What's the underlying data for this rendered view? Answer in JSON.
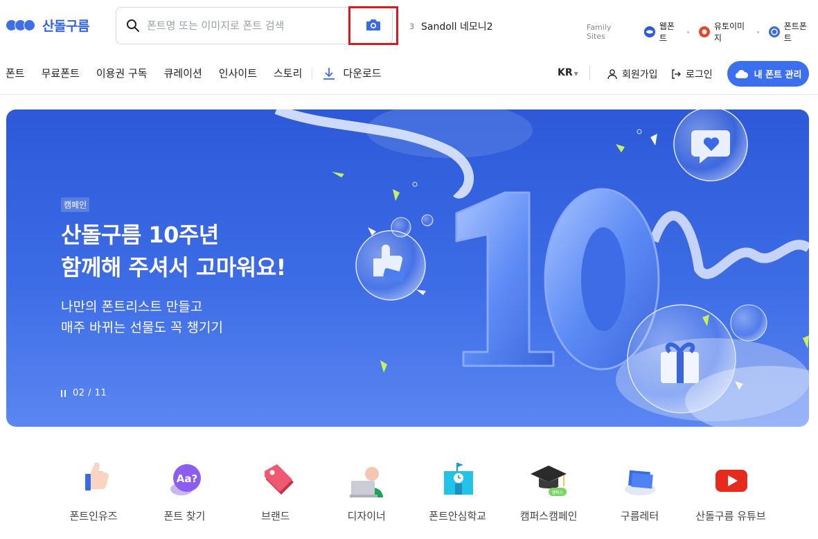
{
  "brand": {
    "name": "산돌구름"
  },
  "search": {
    "placeholder": "폰트명 또는 이미지로 폰트 검색"
  },
  "trending": {
    "rank": "3",
    "keyword": "Sandoll 네모니2"
  },
  "family_sites": {
    "label": "Family Sites",
    "items": [
      {
        "label": "웹폰트",
        "color": "#2f5bd6"
      },
      {
        "label": "유토이미지",
        "color": "#e8452c"
      },
      {
        "label": "폰트폰트",
        "color": "#3a6de2"
      }
    ]
  },
  "nav": {
    "items": [
      "폰트",
      "무료폰트",
      "이용권 구독",
      "큐레이션",
      "인사이트",
      "스토리"
    ],
    "download": "다운로드"
  },
  "header_right": {
    "lang": "KR",
    "signup": "회원가입",
    "login": "로그인",
    "my_fonts": "내 폰트 관리"
  },
  "banner": {
    "badge": "캠페인",
    "title_line1": "산돌구름 10주년",
    "title_line2": "함께해 주셔서 고마워요!",
    "sub_line1": "나만의 폰트리스트 만들고",
    "sub_line2": "매주 바뀌는 선물도 꼭 챙기기",
    "pager": "02 / 11",
    "big_number": "10"
  },
  "quick_links": [
    {
      "label": "폰트인유즈",
      "icon": "thumbs-up-icon"
    },
    {
      "label": "폰트 찾기",
      "icon": "speech-bubble-aa-icon"
    },
    {
      "label": "브랜드",
      "icon": "tag-icon"
    },
    {
      "label": "디자이너",
      "icon": "designer-laptop-icon"
    },
    {
      "label": "폰트안심학교",
      "icon": "school-clock-icon"
    },
    {
      "label": "캠퍼스캠페인",
      "icon": "graduation-cap-icon"
    },
    {
      "label": "구름레터",
      "icon": "letter-cloud-icon"
    },
    {
      "label": "산돌구름 유튜브",
      "icon": "youtube-icon"
    }
  ],
  "colors": {
    "accent": "#3b6ff0",
    "highlight_box": "#d71920",
    "banner_bg": "#3d6ce6"
  }
}
